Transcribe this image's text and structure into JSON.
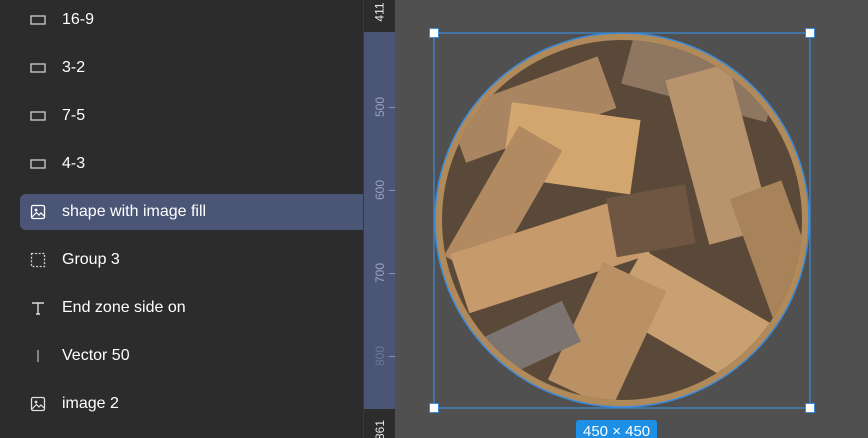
{
  "layers": [
    {
      "name": "16-9",
      "icon": "frame-icon",
      "selected": false
    },
    {
      "name": "3-2",
      "icon": "frame-icon",
      "selected": false
    },
    {
      "name": "7-5",
      "icon": "frame-icon",
      "selected": false
    },
    {
      "name": "4-3",
      "icon": "frame-icon",
      "selected": false
    },
    {
      "name": "shape with image fill",
      "icon": "image-icon",
      "selected": true
    },
    {
      "name": "Group 3",
      "icon": "group-icon",
      "selected": false
    },
    {
      "name": "End zone side on",
      "icon": "text-icon",
      "selected": false
    },
    {
      "name": "Vector 50",
      "icon": "vector-line-icon",
      "selected": false
    },
    {
      "name": "image 2",
      "icon": "image-icon",
      "selected": false
    }
  ],
  "ruler": {
    "labels": [
      "411",
      "500",
      "600",
      "700",
      "800",
      "861"
    ]
  },
  "selection": {
    "size_label": "450 × 450"
  },
  "colors": {
    "panel_bg": "#2c2c2c",
    "canvas_bg": "#505050",
    "selected_row": "#4b5677",
    "selection_stroke": "#3b8bd9",
    "badge_bg": "#1d8fe6",
    "ring": "#b08a5a"
  }
}
